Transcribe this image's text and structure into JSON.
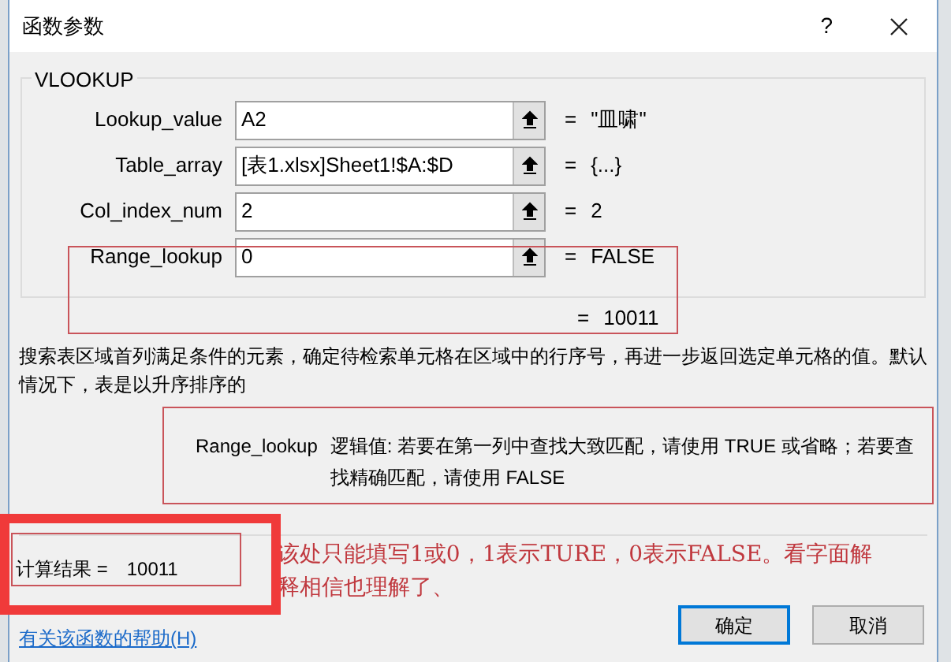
{
  "window": {
    "title": "函数参数",
    "help_button": "?"
  },
  "function_name": "VLOOKUP",
  "arguments": [
    {
      "label": "Lookup_value",
      "value": "A2",
      "equals": "=",
      "result": "\"皿啸\""
    },
    {
      "label": "Table_array",
      "value": "[表1.xlsx]Sheet1!$A:$D",
      "equals": "=",
      "result": "{...}"
    },
    {
      "label": "Col_index_num",
      "value": "2",
      "equals": "=",
      "result": "2"
    },
    {
      "label": "Range_lookup",
      "value": "0",
      "equals": "=",
      "result": "FALSE"
    }
  ],
  "formula_result": {
    "equals": "=",
    "value": "10011"
  },
  "description": "搜索表区域首列满足条件的元素，确定待检索单元格在区域中的行序号，再进一步返回选定单元格的值。默认情况下，表是以升序排序的",
  "argument_help": {
    "name": "Range_lookup",
    "text": "逻辑值: 若要在第一列中查找大致匹配，请使用 TRUE 或省略；若要查找精确匹配，请使用 FALSE"
  },
  "calculation_result": {
    "label": "计算结果 =",
    "value": "10011"
  },
  "annotation": "该处只能填写1或0，1表示TURE，0表示FALSE。看字面解释相信也理解了、",
  "help_link": "有关该函数的帮助(H)",
  "buttons": [
    {
      "label": "确定",
      "selected": true
    },
    {
      "label": "取消",
      "selected": false
    }
  ]
}
